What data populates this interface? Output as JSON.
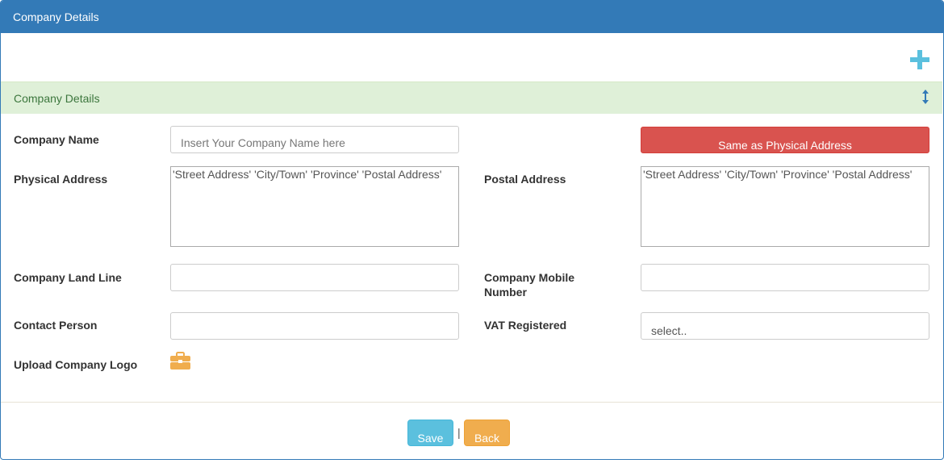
{
  "panel": {
    "title": "Company Details"
  },
  "section": {
    "title": "Company Details"
  },
  "icons": {
    "add": "plus-icon",
    "toggle": "sort-vertical-icon",
    "upload": "briefcase-icon"
  },
  "colors": {
    "primary": "#337ab7",
    "info": "#5bc0de",
    "danger": "#d9534f",
    "warning": "#f0ad4e",
    "success_bg": "#dff0d8",
    "success_text": "#3c763d"
  },
  "form": {
    "company_name": {
      "label": "Company Name",
      "placeholder": "Insert Your Company Name here",
      "value": ""
    },
    "same_as_physical_button": "Same as Physical Address",
    "physical_address": {
      "label": "Physical Address",
      "value": "'Street Address' 'City/Town' 'Province' 'Postal Address'"
    },
    "postal_address": {
      "label": "Postal Address",
      "value": "'Street Address' 'City/Town' 'Province' 'Postal Address'"
    },
    "land_line": {
      "label": "Company Land Line",
      "value": ""
    },
    "mobile_number": {
      "label_line1": "Company Mobile",
      "label_line2": "Number",
      "value": ""
    },
    "contact_person": {
      "label": "Contact Person",
      "value": ""
    },
    "vat_registered": {
      "label": "VAT Registered",
      "selected": "select.."
    },
    "upload_logo": {
      "label": "Upload Company Logo"
    }
  },
  "footer": {
    "save_label": "Save",
    "separator": "|",
    "back_label": "Back"
  }
}
